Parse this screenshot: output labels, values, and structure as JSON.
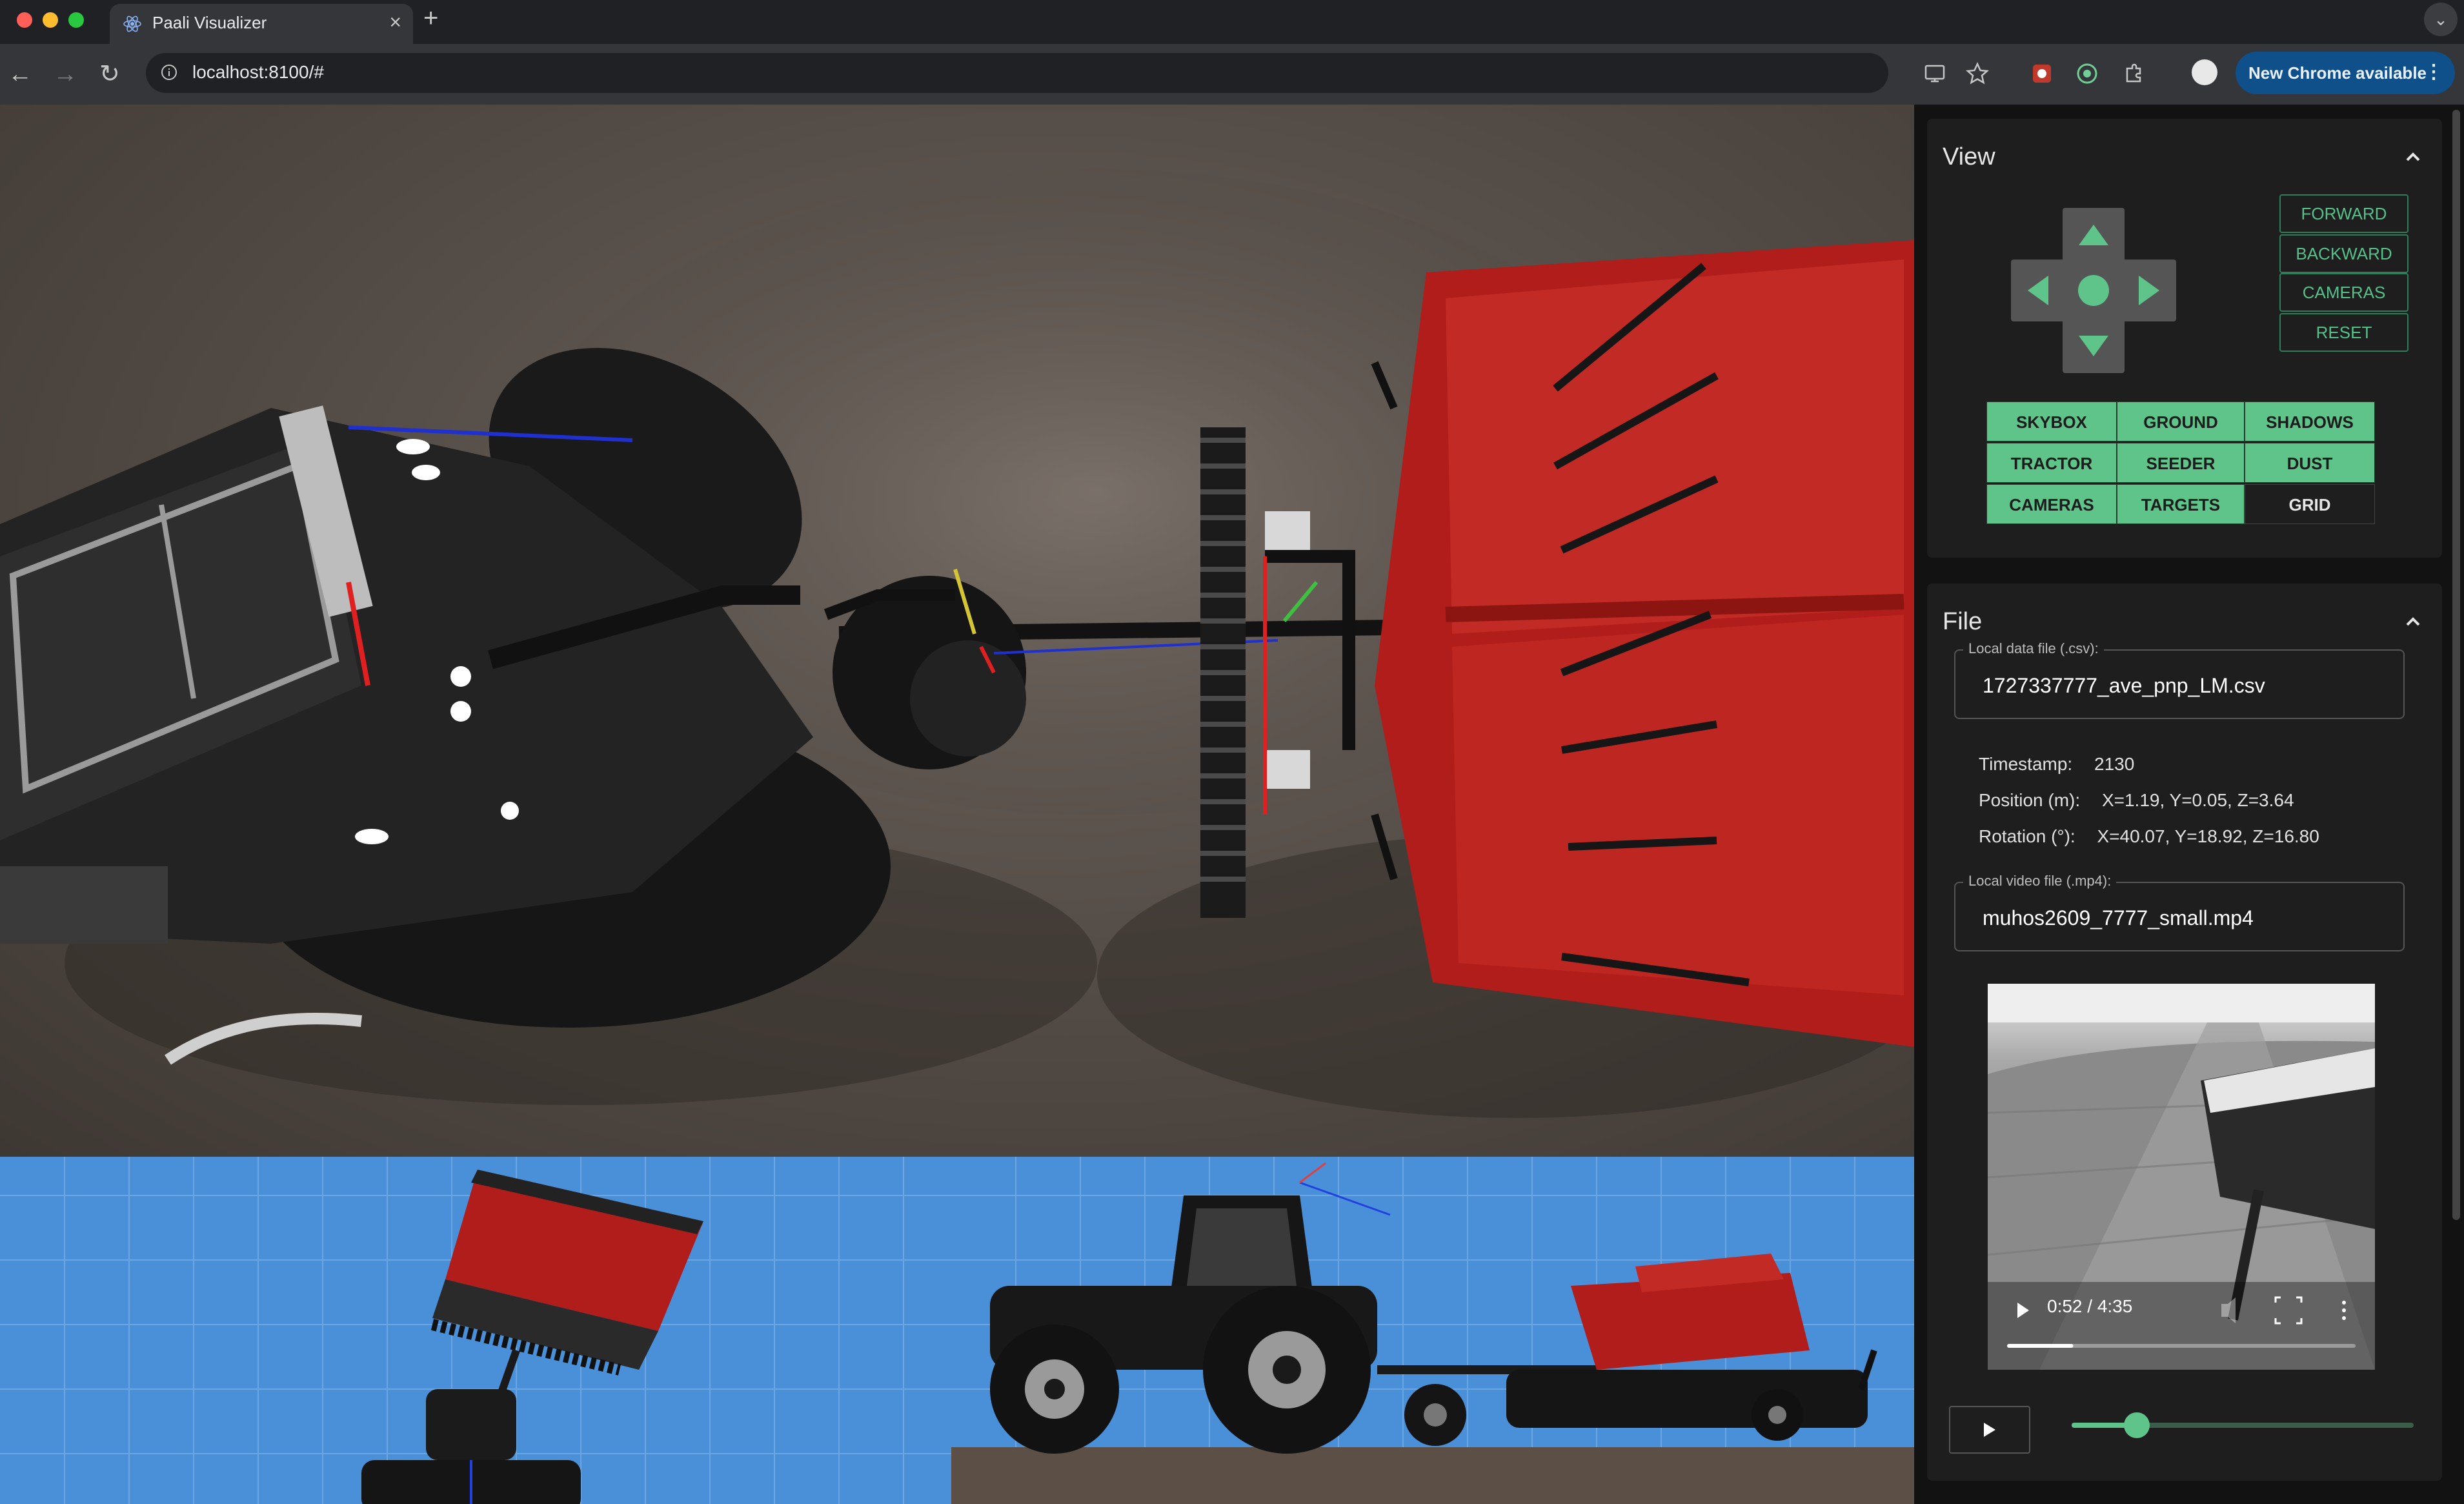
{
  "browser": {
    "tab_title": "Paali Visualizer",
    "tab_close": "×",
    "new_tab": "+",
    "tab_menu": "⌄",
    "url": "localhost:8100/#",
    "update_label": "New Chrome available",
    "menu_glyph": "⋮",
    "back": "←",
    "forward": "→",
    "reload": "↻"
  },
  "view_panel": {
    "title": "View",
    "outline_buttons": [
      "FORWARD",
      "BACKWARD",
      "CAMERAS",
      "RESET"
    ],
    "toggles": [
      {
        "label": "SKYBOX",
        "on": true
      },
      {
        "label": "GROUND",
        "on": true
      },
      {
        "label": "SHADOWS",
        "on": true
      },
      {
        "label": "TRACTOR",
        "on": true
      },
      {
        "label": "SEEDER",
        "on": true
      },
      {
        "label": "DUST",
        "on": true
      },
      {
        "label": "CAMERAS",
        "on": true
      },
      {
        "label": "TARGETS",
        "on": true
      },
      {
        "label": "GRID",
        "on": false
      }
    ]
  },
  "file_panel": {
    "title": "File",
    "csv_label": "Local data file (.csv):",
    "csv_value": "1727337777_ave_pnp_LM.csv",
    "timestamp_label": "Timestamp:",
    "timestamp_value": "2130",
    "position_label": "Position (m):",
    "position_value": "X=1.19, Y=0.05, Z=3.64",
    "rotation_label": "Rotation (°):",
    "rotation_value": "X=40.07, Y=18.92, Z=16.80",
    "video_label": "Local video file (.mp4):",
    "video_value": "muhos2609_7777_small.mp4",
    "video_time": "0:52 / 4:35",
    "video_progress": 0.19,
    "playback_slider": 0.19
  },
  "colors": {
    "accent": "#5fc48a",
    "seeder_red": "#b8201d",
    "ground_blue": "#4a90d9"
  }
}
